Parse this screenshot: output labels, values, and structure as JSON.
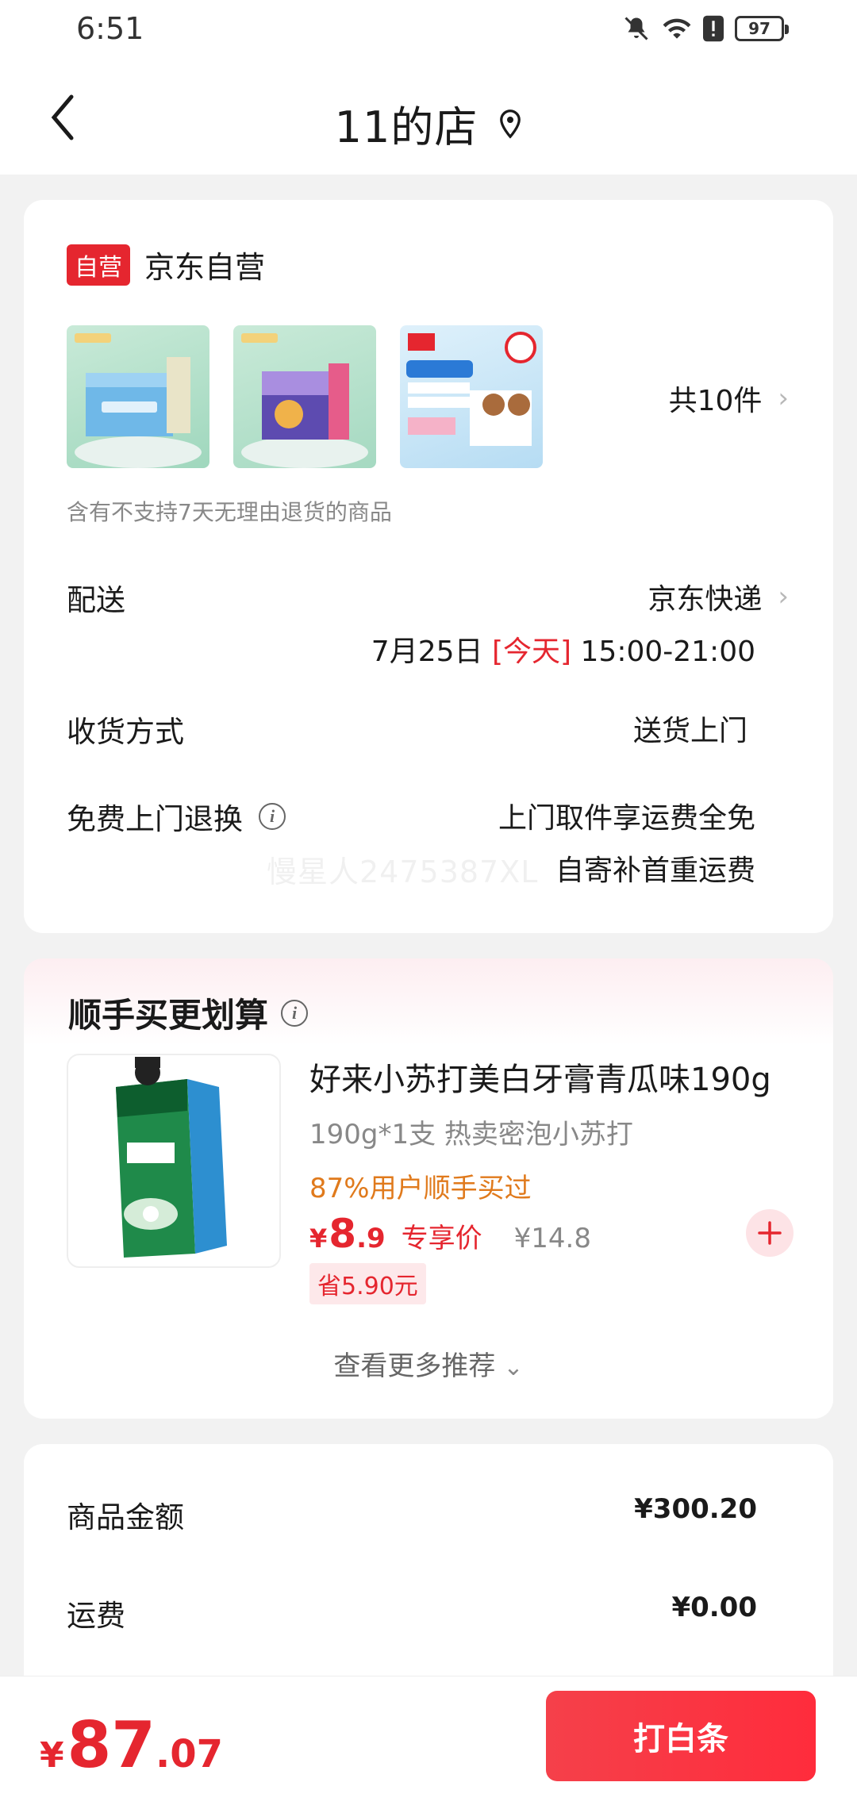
{
  "status_bar": {
    "time": "6:51",
    "battery": "97"
  },
  "nav": {
    "title": "11的店"
  },
  "store": {
    "badge": "自营",
    "name": "京东自营",
    "item_count": "共10件",
    "return_note": "含有不支持7天无理由退货的商品"
  },
  "delivery": {
    "label": "配送",
    "carrier": "京东快递",
    "date": "7月25日",
    "today": "[今天]",
    "window": "15:00-21:00"
  },
  "receive": {
    "label": "收货方式",
    "value": "送货上门"
  },
  "free_return": {
    "label": "免费上门退换",
    "line1": "上门取件享运费全免",
    "line2": "自寄补首重运费"
  },
  "watermark": "慢星人2475387XL",
  "recommend": {
    "title": "顺手买更划算",
    "product": {
      "name": "好来小苏打美白牙膏青瓜味190g",
      "spec": "190g*1支 热卖密泡小苏打",
      "social": "87%用户顺手买过",
      "price_symbol": "¥",
      "price_int": "8",
      "price_dec": ".9",
      "price_tag": "专享价",
      "orig_price": "¥14.8",
      "save": "省5.90元"
    },
    "more": "查看更多推荐"
  },
  "summary": {
    "goods_label": "商品金额",
    "goods_value": "¥300.20",
    "ship_label": "运费",
    "ship_value": "¥0.00"
  },
  "bottom": {
    "yen": "¥",
    "total_int": "87",
    "total_dec": ".07",
    "pay_label": "打白条"
  },
  "colors": {
    "accent": "#e5262f",
    "orange": "#e07a1c",
    "gray": "#888888"
  }
}
